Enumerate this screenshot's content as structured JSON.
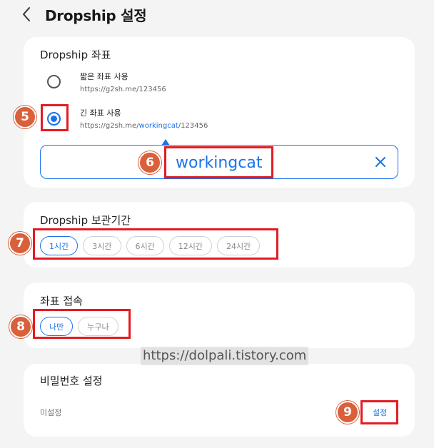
{
  "header": {
    "title": "Dropship 설정"
  },
  "address_card": {
    "title": "Dropship 좌표",
    "options": [
      {
        "label": "짧은 좌표 사용",
        "url": "https://g2sh.me/123456",
        "checked": false
      },
      {
        "label": "긴 좌표 사용",
        "url_prefix": "https://g2sh.me/",
        "url_highlight": "workingcat",
        "url_suffix": "/123456",
        "checked": true
      }
    ],
    "input_value": "workingcat"
  },
  "retention_card": {
    "title": "Dropship 보관기간",
    "chips": [
      "1시간",
      "3시간",
      "6시간",
      "12시간",
      "24시간"
    ],
    "selected": "1시간"
  },
  "access_card": {
    "title": "좌표 접속",
    "chips": [
      "나만",
      "누구나"
    ],
    "selected": "나만"
  },
  "password_card": {
    "title": "비밀번호 설정",
    "status": "미설정",
    "button_label": "설정"
  },
  "annotations": [
    "5",
    "6",
    "7",
    "8",
    "9"
  ],
  "watermark": "https://dolpali.tistory.com",
  "colors": {
    "accent": "#1a73e8",
    "annotation_box": "#e41b23",
    "annotation_badge": "#d9603b"
  }
}
